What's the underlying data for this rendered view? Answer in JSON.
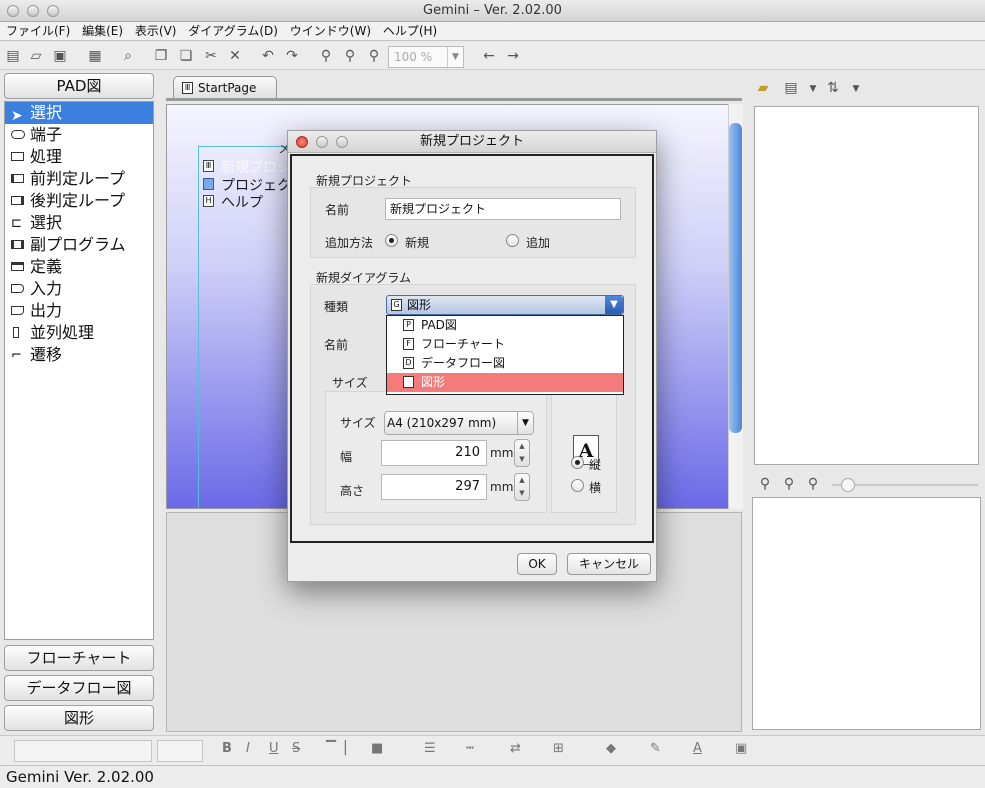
{
  "app_title": "Gemini – Ver. 2.02.00",
  "menu": [
    "ファイル(F)",
    "編集(E)",
    "表示(V)",
    "ダイアグラム(D)",
    "ウインドウ(W)",
    "ヘルプ(H)"
  ],
  "toolbar": {
    "zoom": "100 %"
  },
  "palette": {
    "header": "PAD図",
    "items": [
      "選択",
      "端子",
      "処理",
      "前判定ループ",
      "後判定ループ",
      "選択",
      "副プログラム",
      "定義",
      "入力",
      "出力",
      "並列処理",
      "遷移"
    ],
    "buttons": [
      "フローチャート",
      "データフロー図",
      "図形"
    ]
  },
  "editor": {
    "tab": "StartPage",
    "tab_icon": "Ⅲ",
    "canvas_items": [
      "新規プロジ",
      "プロジェク",
      "ヘルプ"
    ],
    "canvas_header_char": "メ"
  },
  "dialog": {
    "title": "新規プロジェクト",
    "project_group": "新規プロジェクト",
    "name_label": "名前",
    "name_value": "新規プロジェクト",
    "add_method_label": "追加方法",
    "radio_new": "新規",
    "radio_add": "追加",
    "diagram_group": "新規ダイアグラム",
    "type_label": "種類",
    "type_value": "図形",
    "type_icon": "G",
    "type_options": [
      {
        "icon": "P",
        "label": "PAD図"
      },
      {
        "icon": "F",
        "label": "フローチャート"
      },
      {
        "icon": "D",
        "label": "データフロー図"
      },
      {
        "icon": "G",
        "label": "図形"
      }
    ],
    "diagram_name_label": "名前",
    "size_group": "サイズ",
    "size_label": "サイズ",
    "size_value": "A4 (210x297 mm)",
    "width_label": "幅",
    "width_value": "210",
    "height_label": "高さ",
    "height_value": "297",
    "unit": "mm",
    "page_icon_letter": "A",
    "orient_portrait": "縦",
    "orient_landscape": "横",
    "ok": "OK",
    "cancel": "キャンセル"
  },
  "status": "Gemini  Ver. 2.02.00"
}
